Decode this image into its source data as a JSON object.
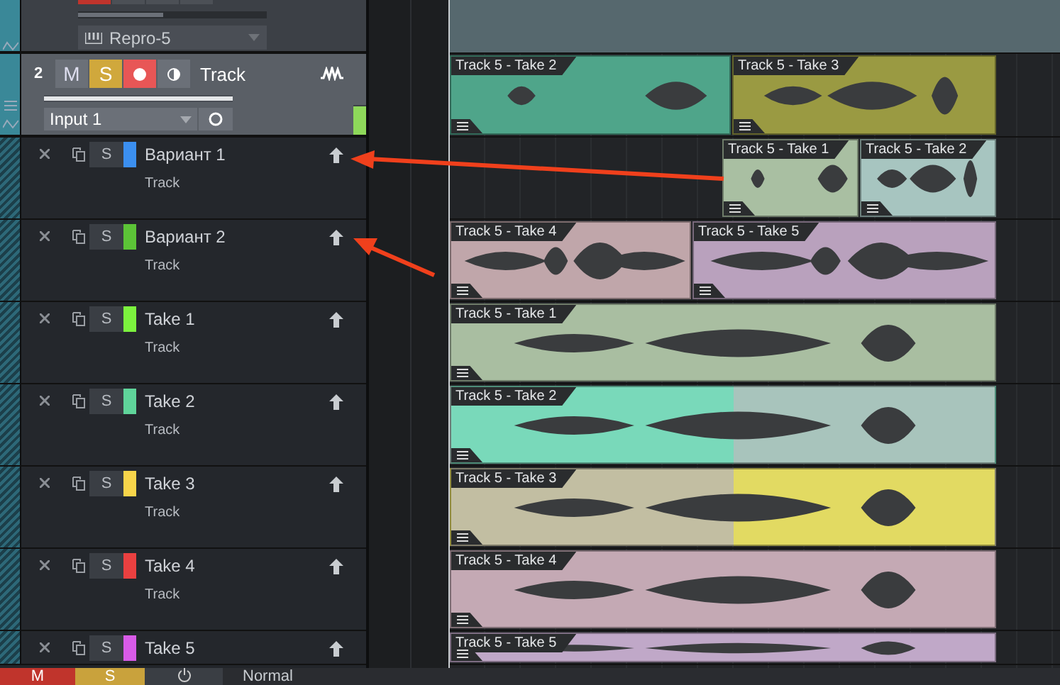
{
  "previous_track": {
    "buttons": [
      {
        "on": true
      },
      {
        "on": false
      },
      {
        "on": false
      },
      {
        "on": false
      }
    ],
    "volume": {
      "level": 0.45
    },
    "instrument": "Repro-5"
  },
  "track": {
    "number": "2",
    "name": "Track",
    "mute": {
      "label": "M",
      "on": false
    },
    "solo": {
      "label": "S",
      "on": true
    },
    "record": {
      "on": true
    },
    "monitor": {
      "on": false
    },
    "volume": {
      "level": 1
    },
    "input": "Input 1",
    "meter": {
      "level": 1
    },
    "clips": [
      {
        "label": "Track 5 - Take 2",
        "color": "#4fa58a"
      },
      {
        "label": "Track 5 - Take 3",
        "color": "#9a9a42"
      }
    ]
  },
  "lanes": [
    {
      "name": "Вариант 1",
      "subtitle": "Track",
      "solo": "S",
      "color": "#3b8ff0",
      "clips": [
        {
          "label": "Track 5 - Take 1",
          "color": "#a9bfa2"
        },
        {
          "label": "Track 5 - Take 2",
          "color": "#a7c5c0"
        }
      ]
    },
    {
      "name": "Вариант 2",
      "subtitle": "Track",
      "solo": "S",
      "color": "#5cc437",
      "clips": [
        {
          "label": "Track 5 - Take 4",
          "color": "#c0a6aa"
        },
        {
          "label": "Track 5 - Take 5",
          "color": "#b9a1bd"
        }
      ]
    },
    {
      "name": "Take 1",
      "subtitle": "Track",
      "solo": "S",
      "color": "#7cf23e",
      "clips": [
        {
          "label": "Track 5 - Take 1",
          "color": "#a9bea1"
        }
      ]
    },
    {
      "name": "Take 2",
      "subtitle": "Track",
      "solo": "S",
      "color": "#5fd49a",
      "clips": [
        {
          "label": "Track 5 - Take 2",
          "color": "#a8c4bc"
        }
      ]
    },
    {
      "name": "Take 3",
      "subtitle": "Track",
      "solo": "S",
      "color": "#f8d54a",
      "clips": [
        {
          "label": "Track 5 - Take 3",
          "color": "#c2bea2"
        }
      ]
    },
    {
      "name": "Take 4",
      "subtitle": "Track",
      "solo": "S",
      "color": "#ea4040",
      "clips": [
        {
          "label": "Track 5 - Take 4",
          "color": "#c4a9b4"
        }
      ]
    },
    {
      "name": "Take 5",
      "solo": "S",
      "color": "#d85be8",
      "clips": [
        {
          "label": "Track 5 - Take 5",
          "color": "#c0a8c8"
        }
      ]
    }
  ],
  "bottom_bar": {
    "mute": "M",
    "solo": "S",
    "mode": "Normal"
  }
}
